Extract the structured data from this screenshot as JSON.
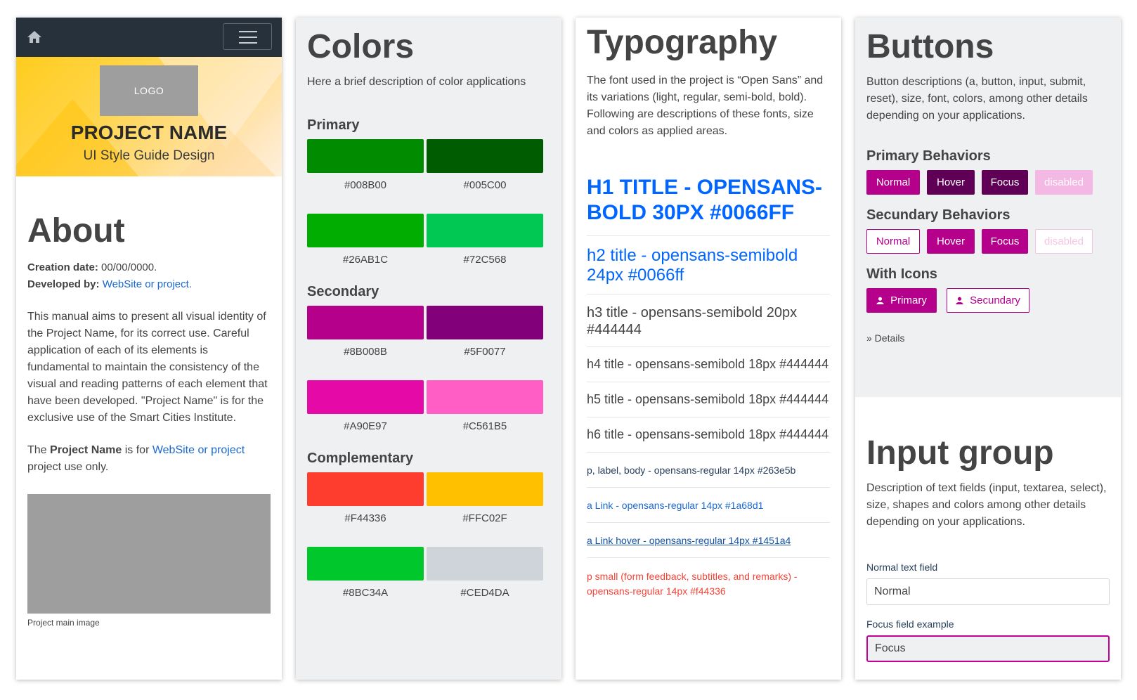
{
  "about": {
    "logo": "LOGO",
    "project_name": "PROJECT NAME",
    "subtitle": "UI Style Guide Design",
    "title": "About",
    "creation_label": "Creation date:",
    "creation_value": " 00/00/0000.",
    "developed_label": "Developed by:",
    "developed_link": "WebSite or project.",
    "paragraph": "This manual aims to present all visual identity of the Project Name, for its correct use. Careful application of each of its elements is fundamental to maintain the consistency of the visual and reading patterns of each element that have been developed. \"Project Name\" is for the exclusive use of the Smart Cities Institute.",
    "usage_prefix": "The ",
    "usage_bold": "Project Name",
    "usage_mid": " is for ",
    "usage_link": "WebSite or project",
    "usage_suffix": " project use only.",
    "image_caption": "Project main image"
  },
  "colors": {
    "title": "Colors",
    "description": "Here a brief description of color applications",
    "sections": [
      {
        "title": "Primary",
        "rows": [
          [
            {
              "hex": "#008B00",
              "color": "#008B00"
            },
            {
              "hex": "#005C00",
              "color": "#005C00"
            }
          ],
          [
            {
              "hex": "#26AB1C",
              "color": "#00AD00"
            },
            {
              "hex": "#72C568",
              "color": "#00C853"
            }
          ]
        ]
      },
      {
        "title": "Secondary",
        "rows": [
          [
            {
              "hex": "#8B008B",
              "color": "#B5008B"
            },
            {
              "hex": "#5F0077",
              "color": "#82007A"
            }
          ],
          [
            {
              "hex": "#A90E97",
              "color": "#E50AA8"
            },
            {
              "hex": "#C561B5",
              "color": "#FF5FC5"
            }
          ]
        ]
      },
      {
        "title": "Complementary",
        "rows": [
          [
            {
              "hex": "#F44336",
              "color": "#FF3D2E"
            },
            {
              "hex": "#FFC02F",
              "color": "#FFC000"
            }
          ],
          [
            {
              "hex": "#8BC34A",
              "color": "#00C72B"
            },
            {
              "hex": "#CED4DA",
              "color": "#CED4DA"
            }
          ]
        ]
      }
    ]
  },
  "typography": {
    "title": "Typography",
    "description": "The font used in the project is “Open Sans” and its variations (light, regular, semi-bold, bold). Following are descriptions of these fonts, size and colors as applied areas.",
    "h1": "H1 TITLE - OPENSANS-BOLD 30PX #0066FF",
    "h2": "h2 title - opensans-semibold 24px #0066ff",
    "h3": "h3 title - opensans-semibold 20px #444444",
    "h4": "h4 title - opensans-semibold 18px #444444",
    "h5": "h5 title - opensans-semibold 18px #444444",
    "h6": "h6 title - opensans-semibold 18px #444444",
    "p": "p, label, body - opensans-regular 14px #263e5b",
    "a": "a Link - opensans-regular 14px #1a68d1",
    "a_hover": "a Link hover - opensans-regular 14px #1451a4",
    "small": "p small (form feedback, subtitles, and remarks) - opensans-regular 14px #f44336"
  },
  "buttons": {
    "title": "Buttons",
    "description": "Button descriptions (a, button, input, submit, reset), size, font, colors, among other details depending on your applications.",
    "primary_title": "Primary Behaviors",
    "primary": {
      "normal": "Normal",
      "hover": "Hover",
      "focus": "Focus",
      "disabled": "disabled"
    },
    "secondary_title": "Secundary Behaviors",
    "secondary": {
      "normal": "Normal",
      "hover": "Hover",
      "focus": "Focus",
      "disabled": "disabled"
    },
    "icons_title": "With Icons",
    "icon_primary": "Primary",
    "icon_secondary": "Secundary",
    "details": "» Details"
  },
  "input_group": {
    "title": "Input group",
    "description": "Description of text fields (input, textarea, select), size, shapes and colors among other details depending on your applications.",
    "normal_label": "Normal text field",
    "normal_value": "Normal",
    "focus_label": "Focus field example",
    "focus_value": "Focus"
  }
}
